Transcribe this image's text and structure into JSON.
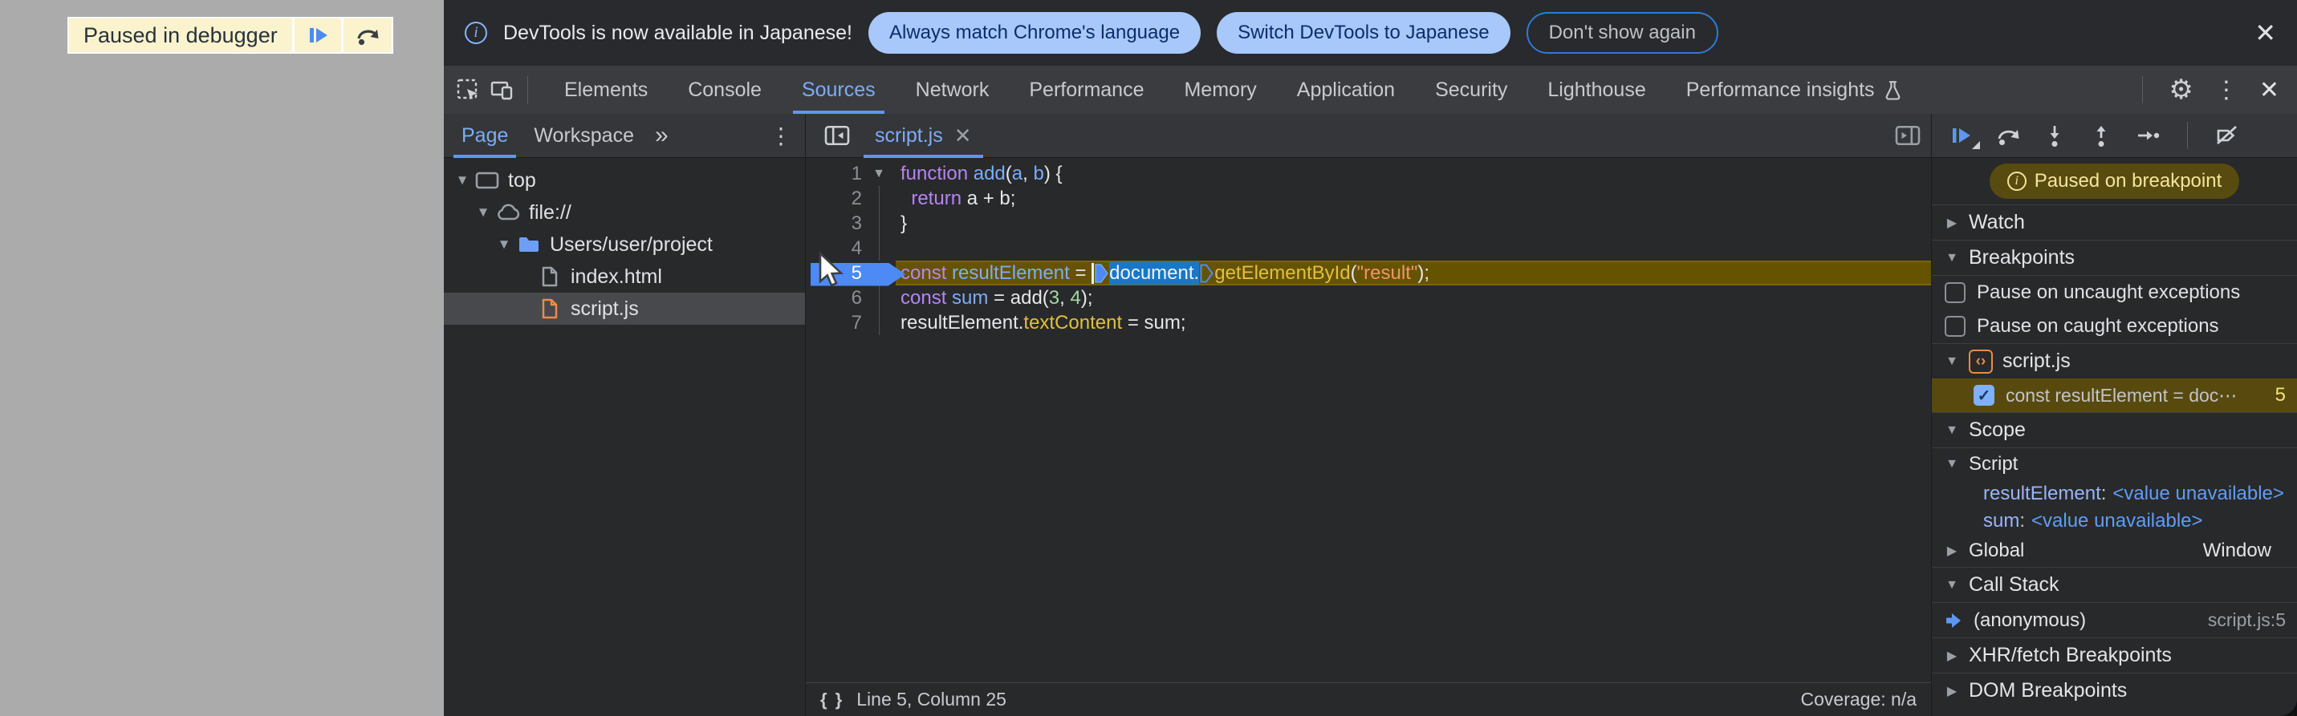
{
  "overlay": {
    "label": "Paused in debugger"
  },
  "notification": {
    "message": "DevTools is now available in Japanese!",
    "action_primary": "Always match Chrome's language",
    "action_secondary": "Switch DevTools to Japanese",
    "action_dismiss": "Don't show again",
    "close": "✕"
  },
  "main_tabs": {
    "items": [
      "Elements",
      "Console",
      "Sources",
      "Network",
      "Performance",
      "Memory",
      "Application",
      "Security",
      "Lighthouse",
      "Performance insights"
    ],
    "active": "Sources"
  },
  "navigator": {
    "tab_page": "Page",
    "tab_workspace": "Workspace",
    "more_tabs": "»",
    "tree": [
      {
        "label": "top",
        "icon": "frame",
        "depth": 0,
        "exp": true
      },
      {
        "label": "file://",
        "icon": "cloud",
        "depth": 1,
        "exp": true
      },
      {
        "label": "Users/user/project",
        "icon": "folder",
        "depth": 2,
        "exp": true
      },
      {
        "label": "index.html",
        "icon": "file-gray",
        "depth": 3
      },
      {
        "label": "script.js",
        "icon": "file-orange",
        "depth": 3,
        "selected": true
      }
    ]
  },
  "editor": {
    "tab": "script.js",
    "tab_close": "✕",
    "lines": [
      {
        "n": 1,
        "fold": true,
        "tokens": [
          [
            "kw",
            "function"
          ],
          [
            "pl",
            " "
          ],
          [
            "def",
            "add"
          ],
          [
            "pl",
            "("
          ],
          [
            "def",
            "a"
          ],
          [
            "pl",
            ", "
          ],
          [
            "def",
            "b"
          ],
          [
            "pl",
            ") {"
          ]
        ]
      },
      {
        "n": 2,
        "guide": true,
        "tokens": [
          [
            "pl",
            "  "
          ],
          [
            "kw",
            "return"
          ],
          [
            "pl",
            " a + b;"
          ]
        ]
      },
      {
        "n": 3,
        "guide": true,
        "tokens": [
          [
            "pl",
            "}"
          ]
        ]
      },
      {
        "n": 4,
        "guide": true,
        "tokens": []
      },
      {
        "n": 5,
        "exec": true,
        "tokens": [
          [
            "kw",
            "const"
          ],
          [
            "pl",
            " "
          ],
          [
            "def",
            "resultElement"
          ],
          [
            "pl",
            " = "
          ],
          [
            "caret",
            ""
          ],
          [
            "mfill",
            ""
          ],
          [
            "sel",
            "document."
          ],
          [
            "mout",
            ""
          ],
          [
            "prop",
            "getElementById"
          ],
          [
            "pl",
            "("
          ],
          [
            "str",
            "\"result\""
          ],
          [
            "pl",
            ");"
          ]
        ]
      },
      {
        "n": 6,
        "guide": true,
        "tokens": [
          [
            "kw",
            "const"
          ],
          [
            "pl",
            " "
          ],
          [
            "def",
            "sum"
          ],
          [
            "pl",
            " = add("
          ],
          [
            "num",
            "3"
          ],
          [
            "pl",
            ", "
          ],
          [
            "num",
            "4"
          ],
          [
            "pl",
            ");"
          ]
        ]
      },
      {
        "n": 7,
        "guide": true,
        "tokens": [
          [
            "pl",
            "resultElement."
          ],
          [
            "prop",
            "textContent"
          ],
          [
            "pl",
            " = sum;"
          ]
        ]
      }
    ],
    "status_icon": "{ }",
    "status_left": "Line 5, Column 25",
    "status_right": "Coverage: n/a"
  },
  "debugger": {
    "paused_badge": "Paused on breakpoint",
    "watch_title": "Watch",
    "breakpoints": {
      "title": "Breakpoints",
      "uncaught": "Pause on uncaught exceptions",
      "caught": "Pause on caught exceptions",
      "file": "script.js",
      "file_badge": "‹›",
      "entry_text": "const resultElement = doc⋯",
      "entry_line": "5"
    },
    "scope": {
      "title": "Scope",
      "script_group": "Script",
      "vars": [
        {
          "name": "resultElement",
          "value": "<value unavailable>"
        },
        {
          "name": "sum",
          "value": "<value unavailable>"
        }
      ],
      "global_label": "Global",
      "global_value": "Window"
    },
    "call_stack": {
      "title": "Call Stack",
      "frame": "(anonymous)",
      "location": "script.js:5"
    },
    "xhr_title": "XHR/fetch Breakpoints",
    "dom_title": "DOM Breakpoints"
  }
}
